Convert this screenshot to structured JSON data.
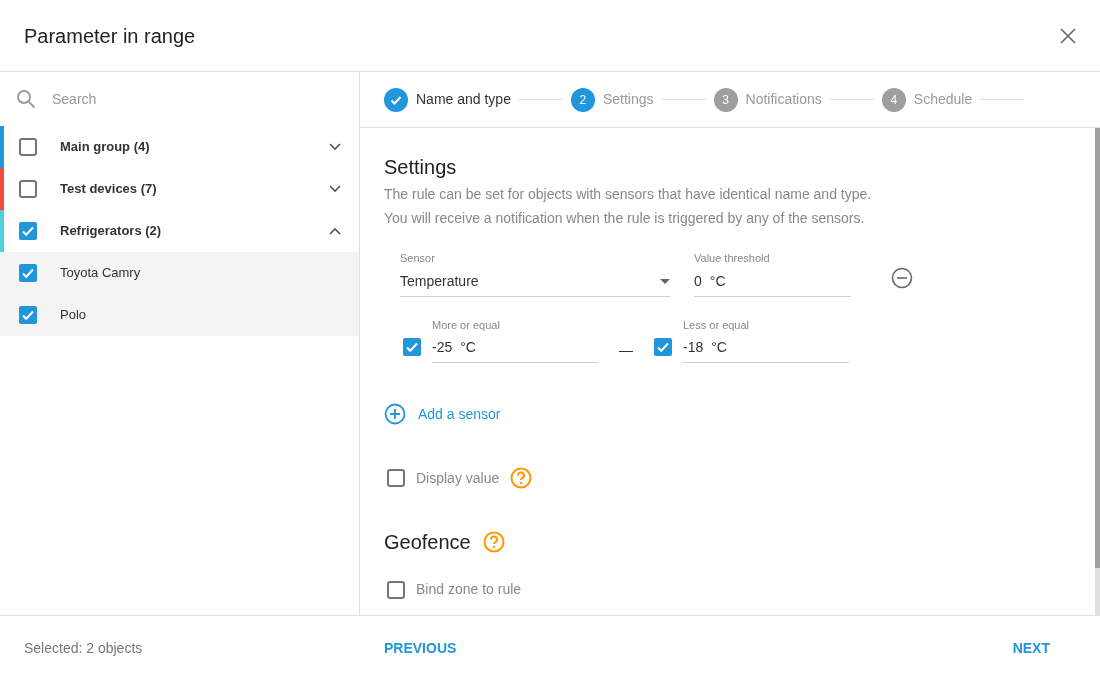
{
  "dialog": {
    "title": "Parameter in range"
  },
  "sidebar": {
    "search": {
      "placeholder": "Search"
    },
    "groups": [
      {
        "label": "Main group (4)",
        "color": "#2196db",
        "checked": false,
        "expanded": false
      },
      {
        "label": "Test devices (7)",
        "color": "#f04a3e",
        "checked": false,
        "expanded": false
      },
      {
        "label": "Refrigerators (2)",
        "color": "#4dd0e1",
        "checked": true,
        "expanded": true,
        "children": [
          {
            "label": "Toyota Camry",
            "checked": true
          },
          {
            "label": "Polo",
            "checked": true
          }
        ]
      }
    ]
  },
  "steps": [
    {
      "kind": "done",
      "label": "Name and type"
    },
    {
      "kind": "current",
      "number": "2",
      "label": "Settings"
    },
    {
      "kind": "pending",
      "number": "3",
      "label": "Notifications"
    },
    {
      "kind": "pending",
      "number": "4",
      "label": "Schedule"
    }
  ],
  "settings": {
    "title": "Settings",
    "description": [
      "The rule can be set for objects with sensors that have identical name and type.",
      "You will receive a notification when the rule is triggered by any of the sensors."
    ],
    "sensor": {
      "label": "Sensor",
      "value": "Temperature"
    },
    "threshold": {
      "label": "Value threshold",
      "value": "0",
      "unit": "°C"
    },
    "min": {
      "label": "More or equal",
      "value": "-25",
      "unit": "°C",
      "checked": true
    },
    "dash": "—",
    "max": {
      "label": "Less or equal",
      "value": "-18",
      "unit": "°C",
      "checked": true
    },
    "add_sensor": "Add a sensor",
    "display_value": {
      "label": "Display value",
      "checked": false
    }
  },
  "geofence": {
    "title": "Geofence",
    "bind": {
      "label": "Bind zone to rule",
      "checked": false
    }
  },
  "footer": {
    "selected": "Selected: 2 objects",
    "previous": "PREVIOUS",
    "next": "NEXT"
  }
}
